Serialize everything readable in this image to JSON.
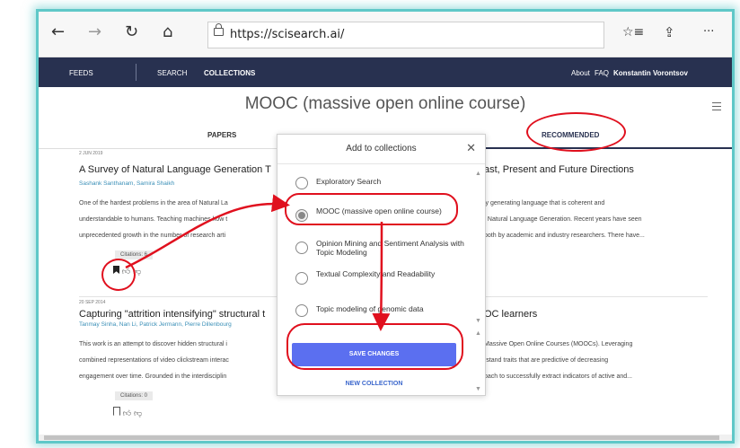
{
  "browser": {
    "back_icon": "←",
    "forward_icon": "→",
    "reload_icon": "↻",
    "home_icon": "⌂",
    "url": "https://scisearch.ai/",
    "favorites_icon": "☆≡",
    "share_icon": "⇪",
    "more_icon": "···"
  },
  "nav": {
    "feeds": "FEEDS",
    "search": "SEARCH",
    "collections": "COLLECTIONS",
    "about": "About",
    "faq": "FAQ",
    "user": "Konstantin Vorontsov"
  },
  "page": {
    "title": "MOOC (massive open online course)",
    "tabs": {
      "papers": "PAPERS",
      "recommended": "RECOMMENDED"
    }
  },
  "papers": [
    {
      "date": "2 JUN 2019",
      "title_left": "A Survey of Natural Language Generation T",
      "title_right": "ast, Present and Future Directions",
      "authors": "Sashank Santhanam, Samira Shaikh",
      "abstract_left": [
        "One of the hardest problems in the area of Natural La",
        "understandable to humans. Teaching machines how t",
        "unprecedented growth in the number of research arti"
      ],
      "abstract_right": [
        "ly generating language that is coherent and",
        "f Natural Language Generation. Recent years have seen",
        "both by academic and industry researchers. There have..."
      ],
      "citations": "Citations: 6",
      "bookmark_icon": "🔖",
      "like_icon": "👍",
      "dislike_icon": "👎"
    },
    {
      "date": "20 SEP 2014",
      "title_left": "Capturing \"attrition intensifying\" structural t",
      "title_right": "OC learners",
      "authors": "Tanmay Sinha, Nan Li, Patrick Jermann, Pierre Dillenbourg",
      "abstract_left": [
        "This work is an attempt to discover hidden structural i",
        "combined representations of video clickstream interac",
        "engagement over time. Grounded in the interdisciplin"
      ],
      "abstract_right": [
        "Massive Open Online Courses (MOOCs). Leveraging",
        "rstand traits that are predictive of decreasing",
        "oach to successfully extract indicators of active and..."
      ],
      "citations": "Citations: 0",
      "bookmark_icon": "🔖",
      "like_icon": "👍",
      "dislike_icon": "👎"
    }
  ],
  "modal": {
    "title": "Add to collections",
    "close_icon": "✕",
    "options": [
      {
        "label": "Exploratory Search",
        "selected": false
      },
      {
        "label": "MOOC (massive open online course)",
        "selected": true
      },
      {
        "label": "Opinion Mining and Sentiment Analysis with Topic Modeling",
        "selected": false
      },
      {
        "label": "Textual Complexity and Readability",
        "selected": false
      },
      {
        "label": "Topic modeling of genomic data",
        "selected": false
      }
    ],
    "save_label": "SAVE CHANGES",
    "new_collection_label": "NEW COLLECTION"
  },
  "colors": {
    "navbar": "#283150",
    "accent": "#5b6ff0",
    "annotation": "#e0101e",
    "frame": "#5fc8c8"
  }
}
